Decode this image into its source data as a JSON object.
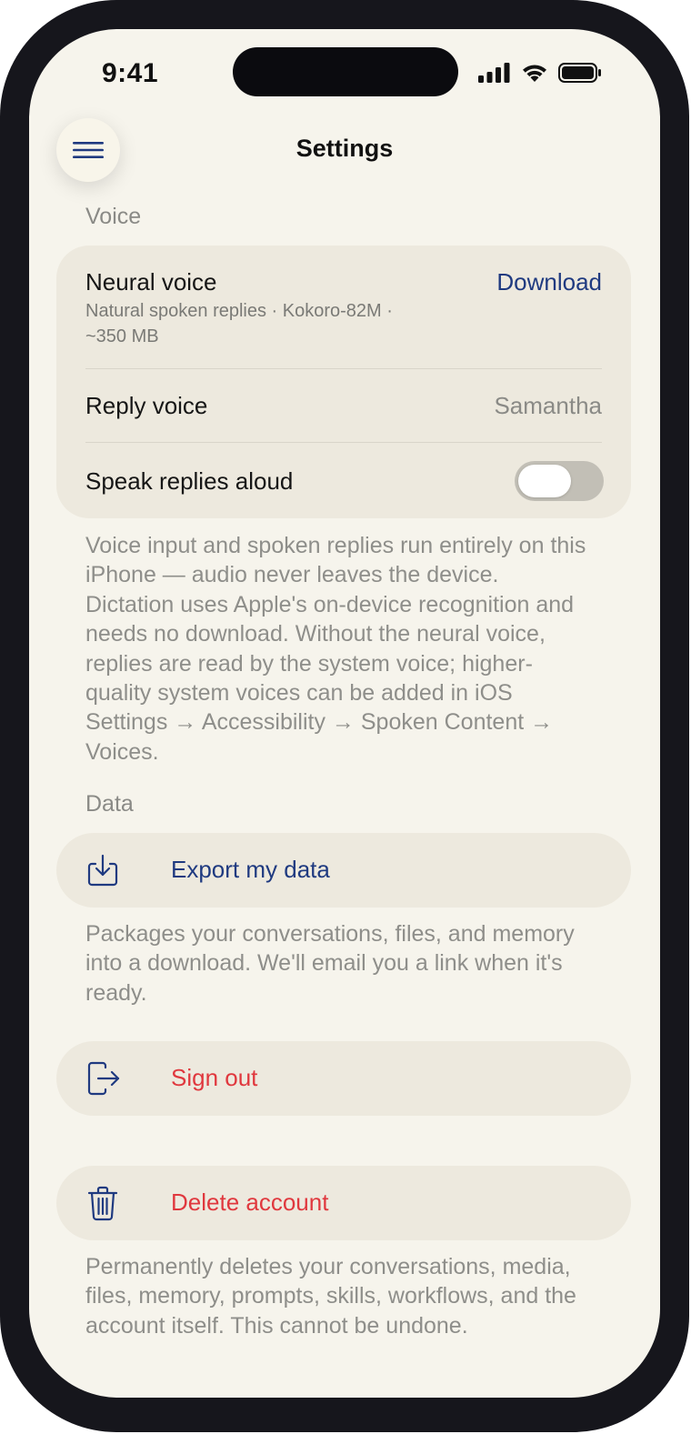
{
  "status_bar": {
    "time": "9:41"
  },
  "header": {
    "title": "Settings"
  },
  "voice": {
    "section_label": "Voice",
    "neural_voice": {
      "title": "Neural voice",
      "subtitle_line1": "Natural spoken replies · Kokoro-82M ·",
      "subtitle_line2": "~350 MB",
      "action": "Download"
    },
    "reply_voice": {
      "title": "Reply voice",
      "value": "Samantha"
    },
    "speak_aloud": {
      "title": "Speak replies aloud",
      "enabled": false
    },
    "footnote": [
      "Voice input and spoken replies run entirely on this",
      "iPhone — audio never leaves the device.",
      "Dictation uses Apple's on-device recognition and",
      "needs no download. Without the neural voice,",
      "replies are read by the system voice; higher-",
      "quality system voices can be added in iOS",
      "Settings → Accessibility → Spoken Content →",
      "Voices."
    ]
  },
  "data": {
    "section_label": "Data",
    "export": {
      "label": "Export my data",
      "icon": "export-download-icon"
    },
    "export_note": [
      "Packages your conversations, files, and memory",
      "into a download. We'll email you a link when it's",
      "ready."
    ],
    "sign_out": {
      "label": "Sign out",
      "icon": "sign-out-icon"
    },
    "delete": {
      "label": "Delete account",
      "icon": "trash-icon"
    },
    "delete_note": [
      "Permanently deletes your conversations, media,",
      "files, memory, prompts, skills, workflows, and the",
      "account itself. This cannot be undone."
    ]
  },
  "colors": {
    "accent": "#1f3a80",
    "destructive": "#e0383e",
    "background": "#f6f4ec",
    "card": "#ede9de"
  }
}
